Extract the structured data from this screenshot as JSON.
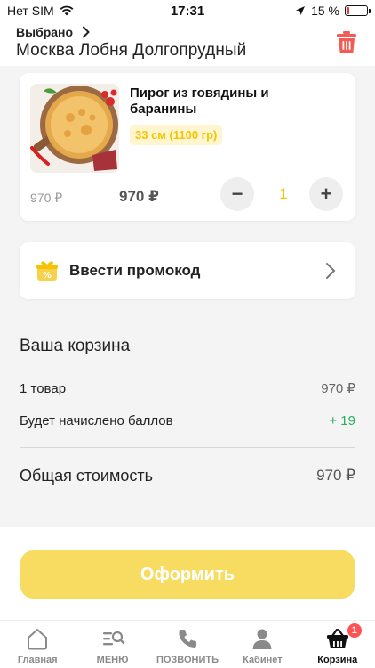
{
  "status_bar": {
    "carrier": "Нет SIM",
    "time": "17:31",
    "battery_percent": "15 %",
    "battery_level": 0.15
  },
  "header": {
    "chosen_label": "Выбрано",
    "location": "Москва Лобня Долгопрудный"
  },
  "cart_item": {
    "name": "Пирог из говядины и баранины",
    "size": "33 см (1100 гр)",
    "old_price": "970 ₽",
    "price": "970 ₽",
    "quantity": "1",
    "minus": "−",
    "plus": "+"
  },
  "promo": {
    "label": "Ввести промокод"
  },
  "summary": {
    "title": "Ваша корзина",
    "items_label": "1 товар",
    "items_value": "970 ₽",
    "bonus_label": "Будет начислено баллов",
    "bonus_value": "+ 19",
    "total_label": "Общая стоимость",
    "total_value": "970 ₽"
  },
  "checkout": {
    "label": "Оформить"
  },
  "tabbar": {
    "home": "Главная",
    "menu": "МЕНЮ",
    "call": "ПОЗВОНИТЬ",
    "account": "Кабинет",
    "cart": "Корзина",
    "cart_badge": "1"
  },
  "colors": {
    "accent": "#f3c400",
    "checkout": "#f7dc61",
    "trash": "#f25c54",
    "bonus": "#27ae60",
    "badge": "#ff5252"
  }
}
